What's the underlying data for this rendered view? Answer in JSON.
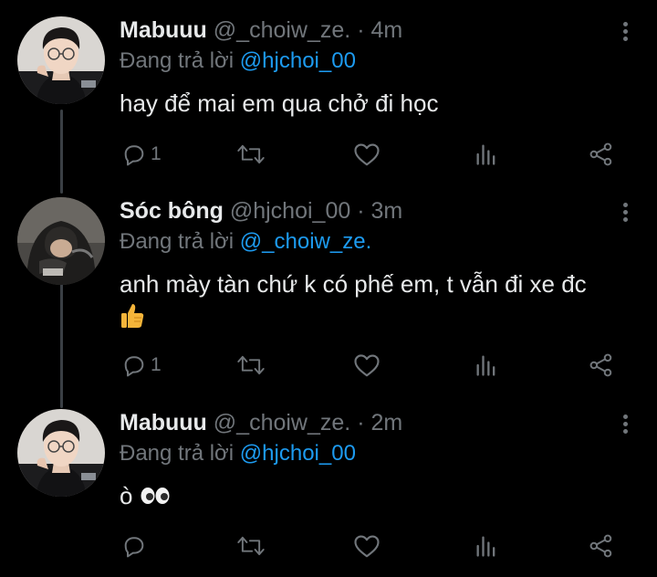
{
  "tweets": [
    {
      "name": "Mabuuu",
      "handle": "@_choiw_ze.",
      "dot": "·",
      "time": "4m",
      "reply_prefix": "Đang trả lời",
      "reply_to": "@hjchoi_00",
      "text": "hay để mai em qua chở đi học",
      "reply_count": "1",
      "retweet_count": "",
      "like_count": "",
      "avatar": "avatar-person-glasses"
    },
    {
      "name": "Sóc bông",
      "handle": "@hjchoi_00",
      "dot": "·",
      "time": "3m",
      "reply_prefix": "Đang trả lời",
      "reply_to": "@_choiw_ze.",
      "text": "anh mày tàn chứ k có phế em, t vẫn đi xe đc",
      "emoji": "thumbs-up",
      "reply_count": "1",
      "retweet_count": "",
      "like_count": "",
      "avatar": "avatar-person-hood"
    },
    {
      "name": "Mabuuu",
      "handle": "@_choiw_ze.",
      "dot": "·",
      "time": "2m",
      "reply_prefix": "Đang trả lời",
      "reply_to": "@hjchoi_00",
      "text": "ò",
      "emoji": "eyes",
      "reply_count": "",
      "retweet_count": "",
      "like_count": "",
      "avatar": "avatar-person-glasses"
    }
  ],
  "colors": {
    "background": "#000000",
    "text": "#e7e9ea",
    "muted": "#71767b",
    "link": "#1d9bf0",
    "thread_line": "#3a3f44"
  },
  "icons": [
    "reply-icon",
    "retweet-icon",
    "like-icon",
    "views-icon",
    "share-icon",
    "more-icon"
  ]
}
